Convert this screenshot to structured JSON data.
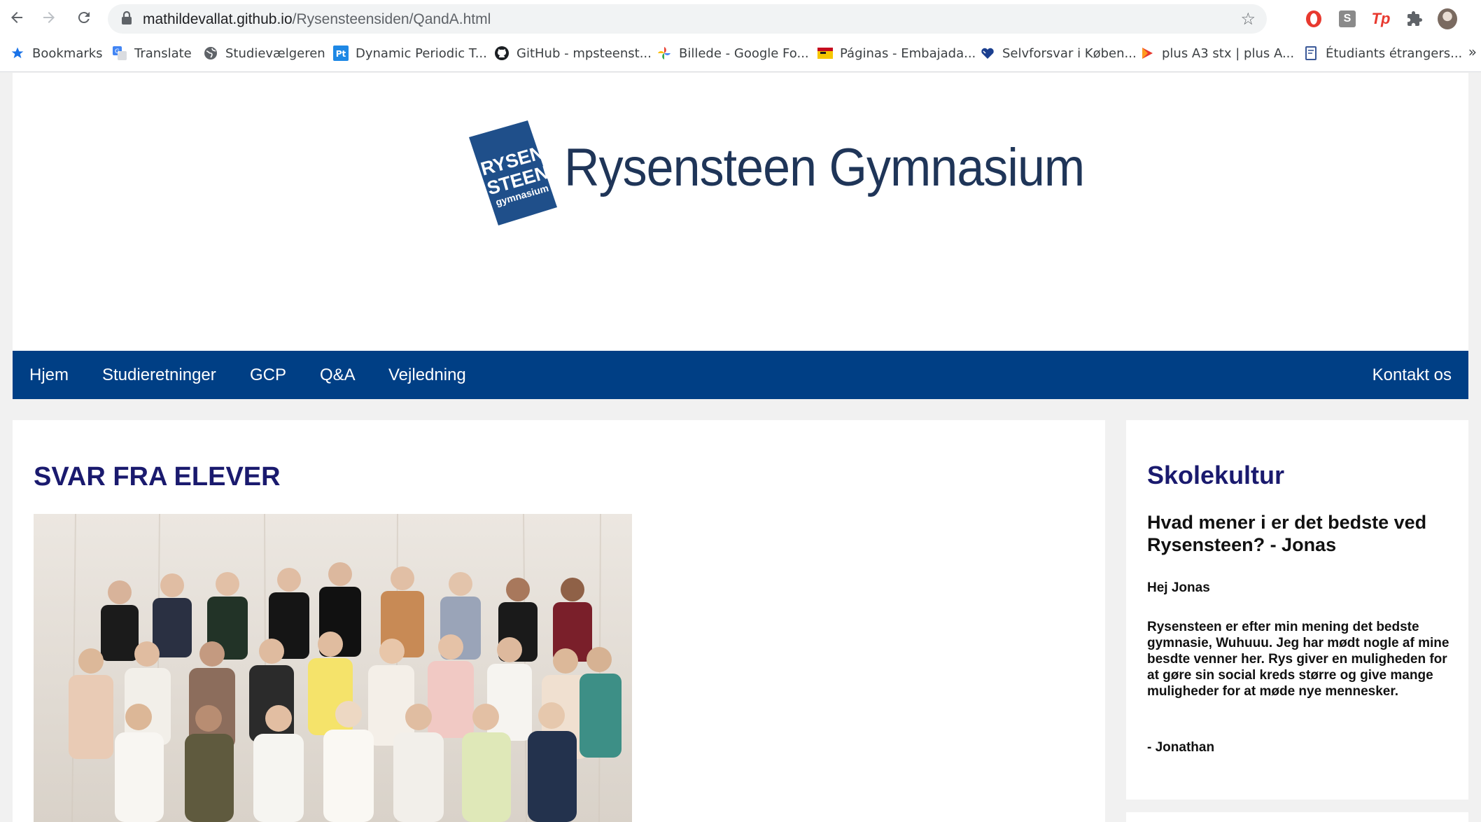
{
  "browser": {
    "url_host": "mathildevallat.github.io",
    "url_path": "/Rysensteensiden/QandA.html",
    "bookmarks": [
      {
        "label": "Bookmarks",
        "icon": "star-icon"
      },
      {
        "label": "Translate",
        "icon": "translate-icon"
      },
      {
        "label": "Studievælgeren",
        "icon": "globe-icon"
      },
      {
        "label": "Dynamic Periodic T...",
        "icon": "pt-icon"
      },
      {
        "label": "GitHub - mpsteenst...",
        "icon": "github-icon"
      },
      {
        "label": "Billede - Google Fo...",
        "icon": "google-photos-icon"
      },
      {
        "label": "Páginas - Embajada...",
        "icon": "flag-icon"
      },
      {
        "label": "Selvforsvar i Køben...",
        "icon": "heart-icon"
      },
      {
        "label": "plus A3 stx | plus A...",
        "icon": "play-icon"
      },
      {
        "label": "Étudiants étrangers...",
        "icon": "document-icon"
      }
    ],
    "extension_labels": {
      "s": "S",
      "tp": "Tp"
    },
    "colors": {
      "accent_red": "#e8392f"
    }
  },
  "site": {
    "logo_badge": {
      "line1": "RYSEN",
      "line2": "STEEN",
      "line3": "gymnasium"
    },
    "logo_name": "Rysensteen Gymnasium",
    "nav": {
      "home": "Hjem",
      "study": "Studieretninger",
      "gcp": "GCP",
      "qa": "Q&A",
      "guidance": "Vejledning",
      "contact": "Kontakt os"
    },
    "colors": {
      "nav_bg": "#003f85",
      "heading": "#1a1a6e"
    }
  },
  "main": {
    "title": "SVAR FRA ELEVER"
  },
  "sidebar": {
    "title": "Skolekultur",
    "question": "Hvad mener i er det bedste ved Rysensteen? - Jonas",
    "greeting": "Hej Jonas",
    "answer": "Rysensteen er efter min mening det bedste gymnasie, Wuhuuu. Jeg har mødt nogle af mine besdte venner her. Rys giver en muligheden for at gøre sin social kreds større og give mange muligheder for at møde nye mennesker.",
    "signature": "- Jonathan"
  }
}
